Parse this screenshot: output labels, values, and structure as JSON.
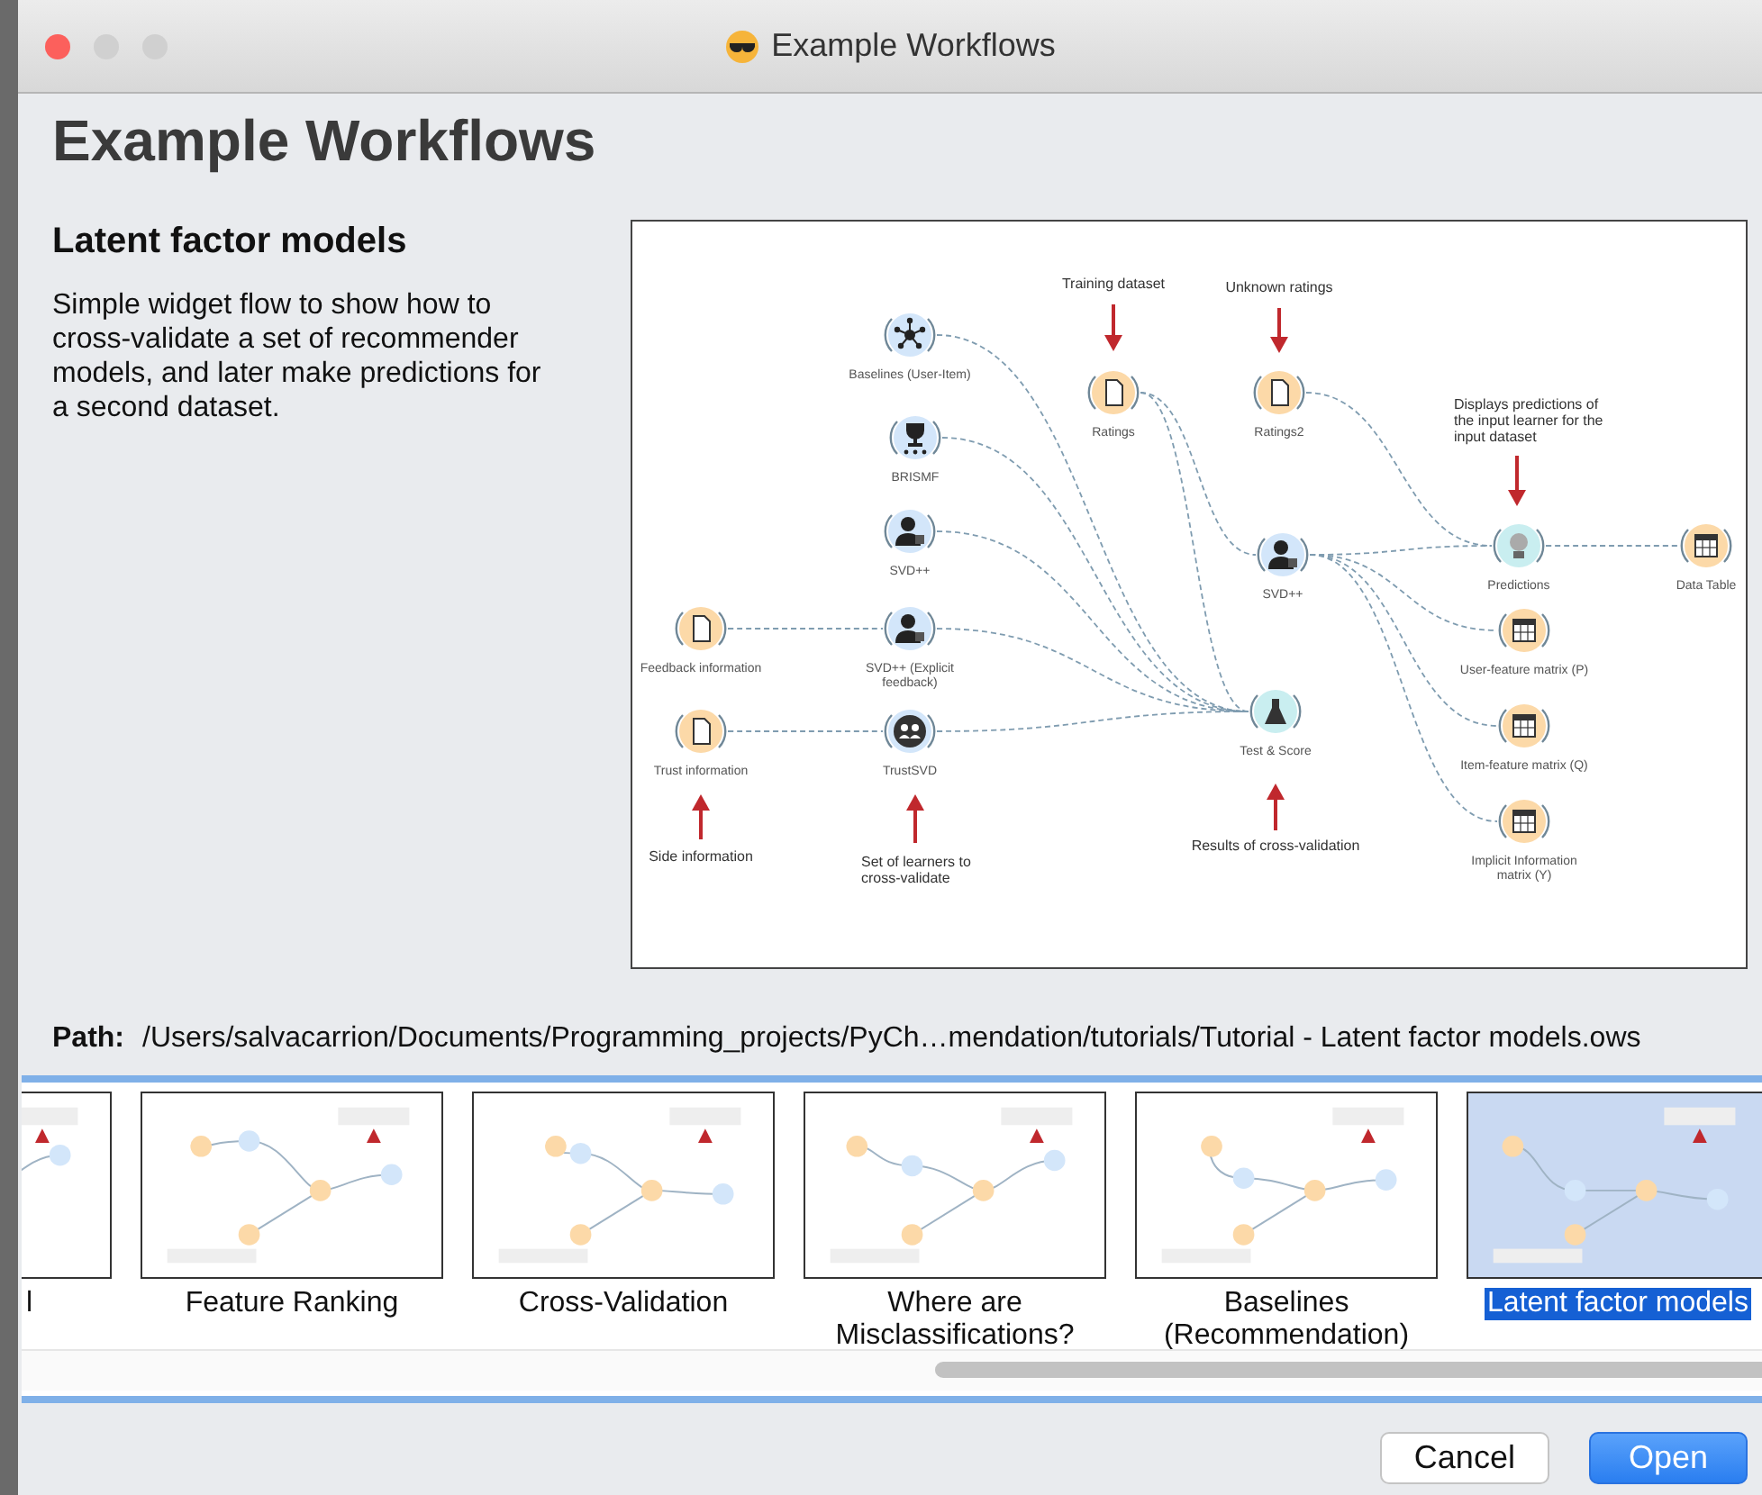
{
  "window": {
    "title": "Example Workflows"
  },
  "heading": "Example Workflows",
  "workflow": {
    "title": "Latent factor models",
    "description": "Simple widget flow to show how to cross-validate a set of recommender models, and later make predictions for a second dataset.",
    "preview": {
      "nodes": [
        {
          "label": "Baselines (User-Item)",
          "kind": "network"
        },
        {
          "label": "BRISMF",
          "kind": "trophy"
        },
        {
          "label": "SVD++",
          "kind": "learner"
        },
        {
          "label": "Feedback information",
          "kind": "data"
        },
        {
          "label": "SVD++ (Explicit feedback)",
          "kind": "learner"
        },
        {
          "label": "Trust information",
          "kind": "data"
        },
        {
          "label": "TrustSVD",
          "kind": "social"
        },
        {
          "label": "Ratings",
          "kind": "data"
        },
        {
          "label": "Ratings2",
          "kind": "data"
        },
        {
          "label": "SVD++",
          "kind": "learner"
        },
        {
          "label": "Test & Score",
          "kind": "evaluator"
        },
        {
          "label": "Predictions",
          "kind": "predictor"
        },
        {
          "label": "Data Table",
          "kind": "table"
        },
        {
          "label": "User-feature matrix (P)",
          "kind": "table"
        },
        {
          "label": "Item-feature matrix (Q)",
          "kind": "table"
        },
        {
          "label": "Implicit Information matrix (Y)",
          "kind": "table"
        }
      ],
      "annotations": [
        {
          "text": "Training dataset",
          "kind": "down"
        },
        {
          "text": "Unknown ratings",
          "kind": "down"
        },
        {
          "text": "Displays predictions of the input learner for the input dataset",
          "kind": "down"
        },
        {
          "text": "Side information",
          "kind": "up"
        },
        {
          "text": "Set of learners to cross-validate",
          "kind": "up"
        },
        {
          "text": "Results of cross-validation",
          "kind": "up"
        }
      ]
    }
  },
  "path": {
    "label": "Path:",
    "value": "/Users/salvacarrion/Documents/Programming_projects/PyCh…mendation/tutorials/Tutorial - Latent factor models.ows"
  },
  "gallery": [
    {
      "title": "l",
      "selected": false
    },
    {
      "title": "Feature Ranking",
      "selected": false
    },
    {
      "title": "Cross-Validation",
      "selected": false
    },
    {
      "title": "Where are Misclassifications?",
      "selected": false
    },
    {
      "title": "Baselines (Recommendation)",
      "selected": false
    },
    {
      "title": "Latent factor models",
      "selected": true
    }
  ],
  "buttons": [
    {
      "label": "Cancel",
      "kind": "secondary"
    },
    {
      "label": "Open",
      "kind": "default"
    }
  ]
}
